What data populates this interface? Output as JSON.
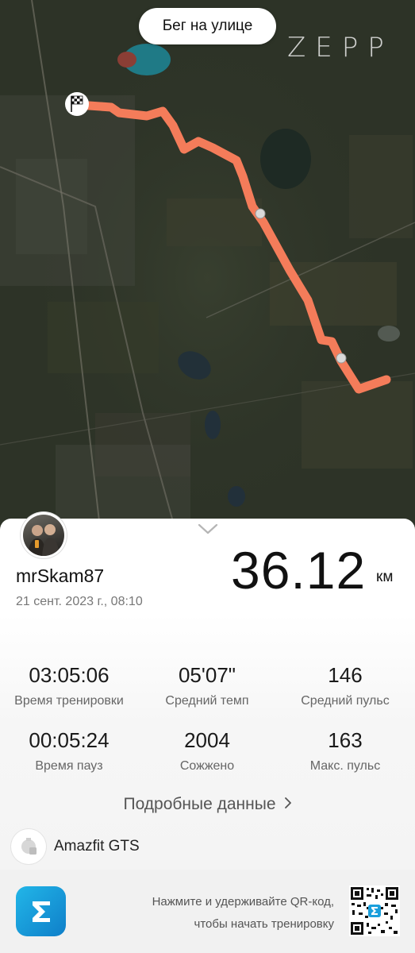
{
  "map": {
    "activity_type": "Бег на улице",
    "brand": "ZEPP"
  },
  "summary": {
    "username": "mrSkam87",
    "datetime": "21 сент. 2023 г., 08:10",
    "distance": "36.12",
    "distance_unit": "км"
  },
  "stats": [
    {
      "value": "03:05:06",
      "label": "Время тренировки"
    },
    {
      "value": "05'07\"",
      "label": "Средний темп"
    },
    {
      "value": "146",
      "label": "Средний пульс"
    },
    {
      "value": "00:05:24",
      "label": "Время пауз"
    },
    {
      "value": "2004",
      "label": "Сожжено"
    },
    {
      "value": "163",
      "label": "Макс. пульс"
    }
  ],
  "details_link": "Подробные данные",
  "device": {
    "name": "Amazfit GTS"
  },
  "footer": {
    "line1": "Нажмите и удерживайте QR-код,",
    "line2": "чтобы начать тренировку"
  },
  "colors": {
    "route": "#f47c5a",
    "app_icon": "#1a9fdc"
  }
}
